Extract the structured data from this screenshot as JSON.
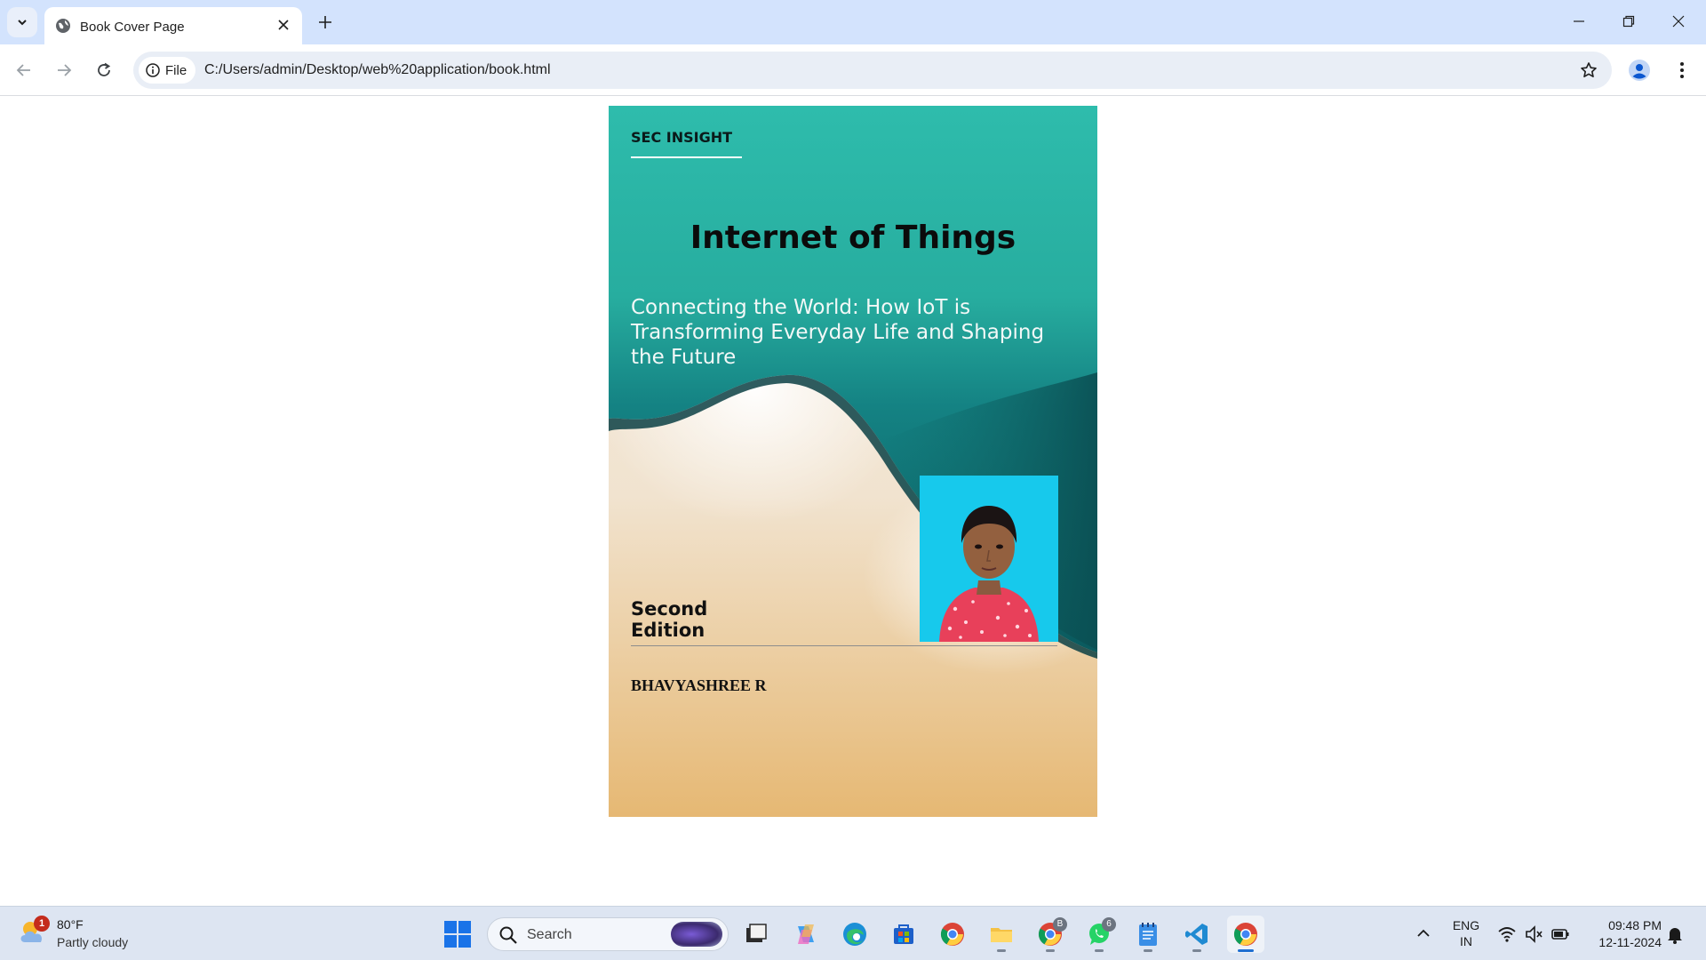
{
  "browser": {
    "tab_title": "Book Cover Page",
    "chip_label": "File",
    "url": "C:/Users/admin/Desktop/web%20application/book.html"
  },
  "cover": {
    "publisher": "SEC INSIGHT",
    "title": "Internet of Things",
    "subtitle": "Connecting the World: How IoT is Transforming Everyday Life and Shaping the Future",
    "edition": "Second Edition",
    "author": "BHAVYASHREE R",
    "colors": {
      "teal": "#2ebcac",
      "teal_dark": "#0f6c6c",
      "sand": "#e6b873",
      "photo_bg": "#17c9ec"
    }
  },
  "taskbar": {
    "weather_badge": "1",
    "weather_temp": "80°F",
    "weather_desc": "Partly cloudy",
    "search_label": "Search",
    "apps": [
      {
        "name": "task-view",
        "icon": "task-view-icon"
      },
      {
        "name": "copilot",
        "icon": "copilot-icon"
      },
      {
        "name": "edge",
        "icon": "edge-icon"
      },
      {
        "name": "store",
        "icon": "store-icon"
      },
      {
        "name": "chrome",
        "icon": "chrome-icon"
      },
      {
        "name": "file-explorer",
        "icon": "folder-icon"
      },
      {
        "name": "chrome-profile",
        "icon": "chrome-icon",
        "badge": "B"
      },
      {
        "name": "whatsapp",
        "icon": "whatsapp-icon",
        "badge": "6"
      },
      {
        "name": "notepad",
        "icon": "notepad-icon"
      },
      {
        "name": "vscode",
        "icon": "vscode-icon"
      },
      {
        "name": "chrome-active",
        "icon": "chrome-icon"
      }
    ],
    "lang_line1": "ENG",
    "lang_line2": "IN",
    "time": "09:48 PM",
    "date": "12-11-2024"
  }
}
